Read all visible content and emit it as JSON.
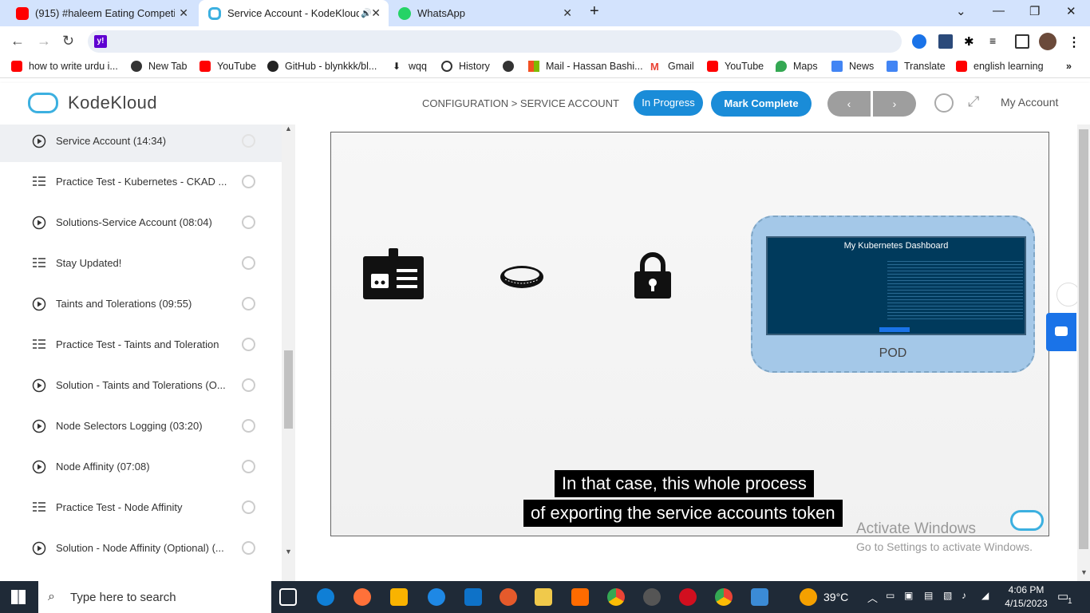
{
  "browser": {
    "tabs": [
      {
        "title": "(915) #haleem Eating Competitio",
        "favicon": "youtube-icon"
      },
      {
        "title": "Service Account - KodeKloud",
        "favicon": "kodekloud-icon"
      },
      {
        "title": "WhatsApp",
        "favicon": "whatsapp-icon"
      }
    ],
    "new_tab": "+",
    "bookmarks": [
      {
        "label": "how to write urdu i...",
        "icon": "youtube-icon"
      },
      {
        "label": "New Tab",
        "icon": "globe-icon"
      },
      {
        "label": "YouTube",
        "icon": "youtube-icon"
      },
      {
        "label": "GitHub - blynkkk/bl...",
        "icon": "github-icon"
      },
      {
        "label": "wqq",
        "icon": "download-icon"
      },
      {
        "label": "History",
        "icon": "history-icon"
      },
      {
        "label": "",
        "icon": "globe-icon"
      },
      {
        "label": "Mail - Hassan Bashi...",
        "icon": "microsoft-icon"
      },
      {
        "label": "Gmail",
        "icon": "gmail-icon"
      },
      {
        "label": "YouTube",
        "icon": "youtube-icon"
      },
      {
        "label": "Maps",
        "icon": "maps-icon"
      },
      {
        "label": "News",
        "icon": "news-icon"
      },
      {
        "label": "Translate",
        "icon": "translate-icon"
      },
      {
        "label": "english learning",
        "icon": "youtube-icon"
      }
    ]
  },
  "header": {
    "logo_text": "KodeKloud",
    "breadcrumb": "CONFIGURATION > SERVICE ACCOUNT",
    "status_btn": "In Progress",
    "complete_btn": "Mark Complete",
    "prev": "‹",
    "next": "›",
    "account": "My Account"
  },
  "sidebar": {
    "items": [
      {
        "label": "Service Account (14:34)",
        "type": "video"
      },
      {
        "label": "Practice Test - Kubernetes - CKAD ...",
        "type": "lab"
      },
      {
        "label": "Solutions-Service Account (08:04)",
        "type": "video"
      },
      {
        "label": "Stay Updated!",
        "type": "lab"
      },
      {
        "label": "Taints and Tolerations (09:55)",
        "type": "video"
      },
      {
        "label": "Practice Test - Taints and Toleration",
        "type": "lab"
      },
      {
        "label": "Solution - Taints and Tolerations (O...",
        "type": "video"
      },
      {
        "label": "Node Selectors Logging (03:20)",
        "type": "video"
      },
      {
        "label": "Node Affinity (07:08)",
        "type": "video"
      },
      {
        "label": "Practice Test - Node Affinity",
        "type": "lab"
      },
      {
        "label": "Solution - Node Affinity (Optional) (...",
        "type": "video"
      }
    ]
  },
  "video": {
    "dashboard_title": "My Kubernetes Dashboard",
    "pod_label": "POD",
    "caption_line1": "In that case, this whole process",
    "caption_line2": "of exporting the service accounts token"
  },
  "watermark": {
    "line1": "Activate Windows",
    "line2": "Go to Settings to activate Windows."
  },
  "taskbar": {
    "search_placeholder": "Type here to search",
    "weather": "39°C",
    "time": "4:06 PM",
    "date": "4/15/2023",
    "notification_count": "1"
  },
  "colors": {
    "accent": "#1a8cd8",
    "brand": "#3cb0e0"
  }
}
